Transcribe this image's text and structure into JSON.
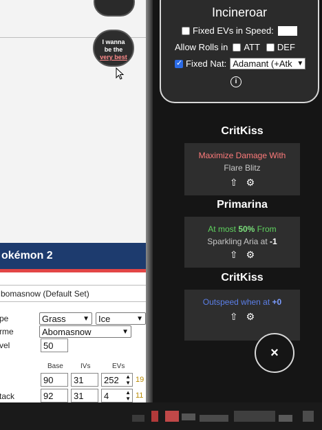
{
  "left": {
    "easter_egg": {
      "line1": "I wanna",
      "line2": "be the",
      "link": "very best"
    },
    "pokemon_header": "okémon 2",
    "set_select": "bomasnow (Default Set)",
    "labels": {
      "type": "pe",
      "forme": "rme",
      "level": "vel"
    },
    "type1": "Grass",
    "type2": "Ice",
    "forme": "Abomasnow",
    "level": "50",
    "columns": {
      "base": "Base",
      "ivs": "IVs",
      "evs": "EVs"
    },
    "stats": [
      {
        "label": "",
        "base": "90",
        "iv": "31",
        "ev": "252",
        "total": "19"
      },
      {
        "label": "tack",
        "base": "92",
        "iv": "31",
        "ev": "4",
        "total": "11"
      }
    ]
  },
  "panel": {
    "title": "Incineroar",
    "fixed_evs_label": "Fixed EVs in Speed:",
    "allow_rolls_label": "Allow Rolls in",
    "att_label": "ATT",
    "def_label": "DEF",
    "fixed_nat_label": "Fixed Nat:",
    "nature_value": "Adamant (+Atk",
    "info_icon": "info-icon",
    "fixed_nat_checked": true,
    "sections": [
      {
        "title": "CritKiss",
        "line1": "Maximize Damage With",
        "line2": "Flare Blitz",
        "color": "#ff7b7b"
      },
      {
        "title": "Primarina",
        "line1_a": "At most ",
        "line1_b": "50%",
        "line1_c": " From",
        "line2_a": "Sparkling Aria at ",
        "line2_b": "-1",
        "color": "#5fd35f"
      },
      {
        "title": "CritKiss",
        "line1_a": "Outspeed when at ",
        "line1_b": "+0",
        "color": "#5b7fe8"
      }
    ],
    "close_label": "×"
  }
}
